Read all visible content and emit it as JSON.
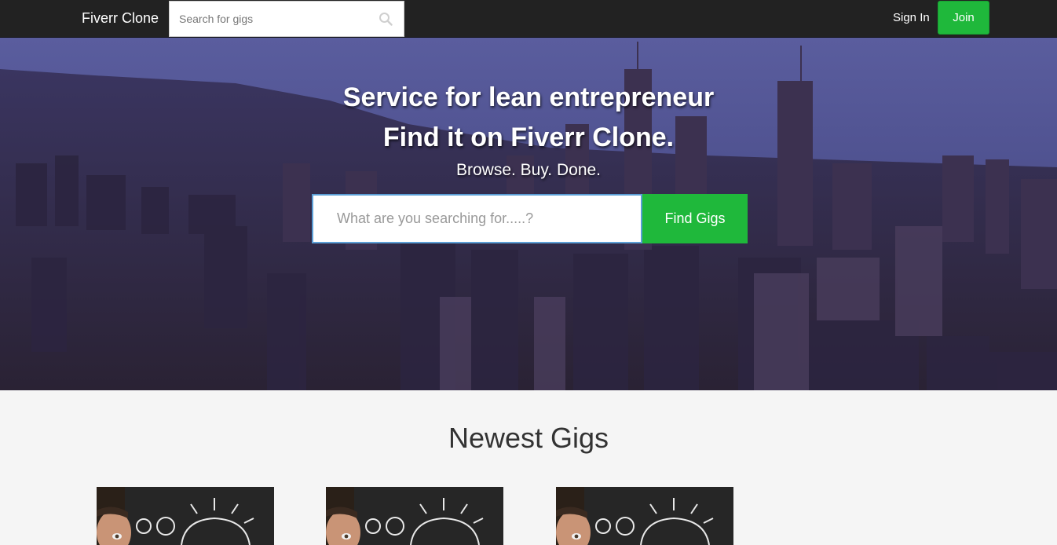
{
  "navbar": {
    "brand": "Fiverr Clone",
    "search_placeholder": "Search for gigs",
    "signin_label": "Sign In",
    "join_label": "Join"
  },
  "hero": {
    "title_line1": "Service for lean entrepreneur",
    "title_line2": "Find it on Fiverr Clone.",
    "subtitle": "Browse. Buy. Done.",
    "search_placeholder": "What are you searching for.....?",
    "search_button": "Find Gigs"
  },
  "newest_gigs": {
    "title": "Newest Gigs",
    "cards": [
      {
        "image": "blog-chalkboard-man"
      },
      {
        "image": "blog-chalkboard-man"
      },
      {
        "image": "blog-chalkboard-man"
      }
    ]
  },
  "colors": {
    "navbar_bg": "#222222",
    "accent_green": "#1fb83b",
    "page_bg": "#f5f5f5"
  }
}
